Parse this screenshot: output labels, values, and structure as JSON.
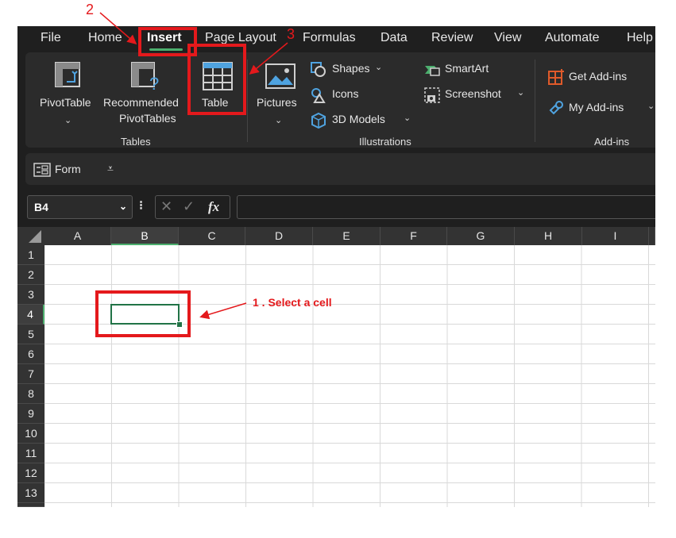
{
  "colors": {
    "accent": "#4caf6e",
    "annotation": "#e4191c",
    "app_bg": "#1f1f1f",
    "ribbon_bg": "#2b2b2b"
  },
  "tabs": [
    {
      "label": "File"
    },
    {
      "label": "Home"
    },
    {
      "label": "Insert",
      "active": true
    },
    {
      "label": "Page Layout"
    },
    {
      "label": "Formulas"
    },
    {
      "label": "Data"
    },
    {
      "label": "Review"
    },
    {
      "label": "View"
    },
    {
      "label": "Automate"
    },
    {
      "label": "Help"
    }
  ],
  "ribbon": {
    "tables": {
      "group_label": "Tables",
      "pivottable": {
        "label": "PivotTable",
        "icon": "pivottable-icon"
      },
      "recommended": {
        "label1": "Recommended",
        "label2": "PivotTables",
        "icon": "recommended-pivottables-icon"
      },
      "table": {
        "label": "Table",
        "icon": "table-icon"
      }
    },
    "illustrations": {
      "group_label": "Illustrations",
      "pictures": {
        "label": "Pictures",
        "icon": "picture-icon"
      },
      "shapes": {
        "label": "Shapes",
        "icon": "shapes-icon"
      },
      "icons": {
        "label": "Icons",
        "icon": "icons-icon"
      },
      "models": {
        "label": "3D Models",
        "icon": "cube-icon"
      },
      "smartart": {
        "label": "SmartArt",
        "icon": "smartart-icon"
      },
      "screenshot": {
        "label": "Screenshot",
        "icon": "camera-icon"
      }
    },
    "addins": {
      "group_label": "Add-ins",
      "get": {
        "label": "Get Add-ins",
        "icon": "store-icon"
      },
      "my": {
        "label": "My Add-ins",
        "icon": "addins-icon"
      }
    }
  },
  "qat": {
    "form_label": "Form",
    "icon": "form-icon"
  },
  "formula_bar": {
    "name_box": "B4",
    "fx": "fx",
    "value": ""
  },
  "columns": [
    "A",
    "B",
    "C",
    "D",
    "E",
    "F",
    "G",
    "H",
    "I"
  ],
  "selected_column": "B",
  "rows": [
    "1",
    "2",
    "3",
    "4",
    "5",
    "6",
    "7",
    "8",
    "9",
    "10",
    "11",
    "12",
    "13"
  ],
  "selected_row": "4",
  "selected_cell": "B4",
  "annotations": {
    "step1": "1 . Select a cell",
    "step2": "2",
    "step3": "3"
  }
}
